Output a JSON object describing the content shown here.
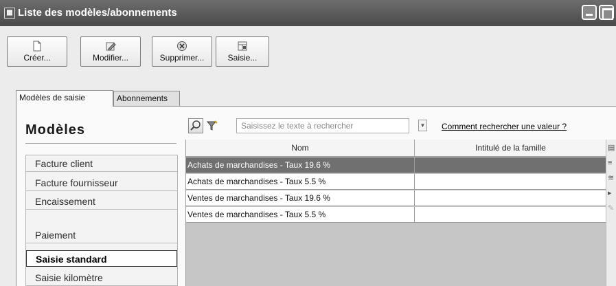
{
  "window": {
    "title": "Liste des modèles/abonnements",
    "icon": "app-grid-icon"
  },
  "toolbar": {
    "create_label": "Créer...",
    "edit_label": "Modifier...",
    "delete_label": "Supprimer...",
    "entry_label": "Saisie..."
  },
  "tabs": [
    {
      "label": "Modèles de saisie",
      "active": true
    },
    {
      "label": "Abonnements",
      "active": false
    }
  ],
  "models": {
    "heading": "Modèles",
    "items": [
      {
        "label": "Facture client"
      },
      {
        "label": "Facture fournisseur"
      },
      {
        "label": "Encaissement"
      },
      {
        "label": "Paiement"
      },
      {
        "label": "Saisie standard",
        "selected": true
      },
      {
        "label": "Saisie kilomètre"
      }
    ]
  },
  "search": {
    "placeholder": "Saisissez le texte à rechercher",
    "help_link": "Comment rechercher une valeur ?"
  },
  "grid": {
    "columns": [
      "Nom",
      "Intitulé de la famille"
    ],
    "rows": [
      {
        "name": "Achats de marchandises - Taux 19.6 %",
        "family": "",
        "selected": true
      },
      {
        "name": "Achats de marchandises - Taux 5.5 %",
        "family": ""
      },
      {
        "name": "Ventes de marchandises - Taux 19.6 %",
        "family": ""
      },
      {
        "name": "Ventes de marchandises - Taux 5.5 %",
        "family": ""
      }
    ]
  },
  "colors": {
    "titlebar": "#555555",
    "selected_row": "#707070",
    "grid_empty": "#c6c6c6"
  }
}
